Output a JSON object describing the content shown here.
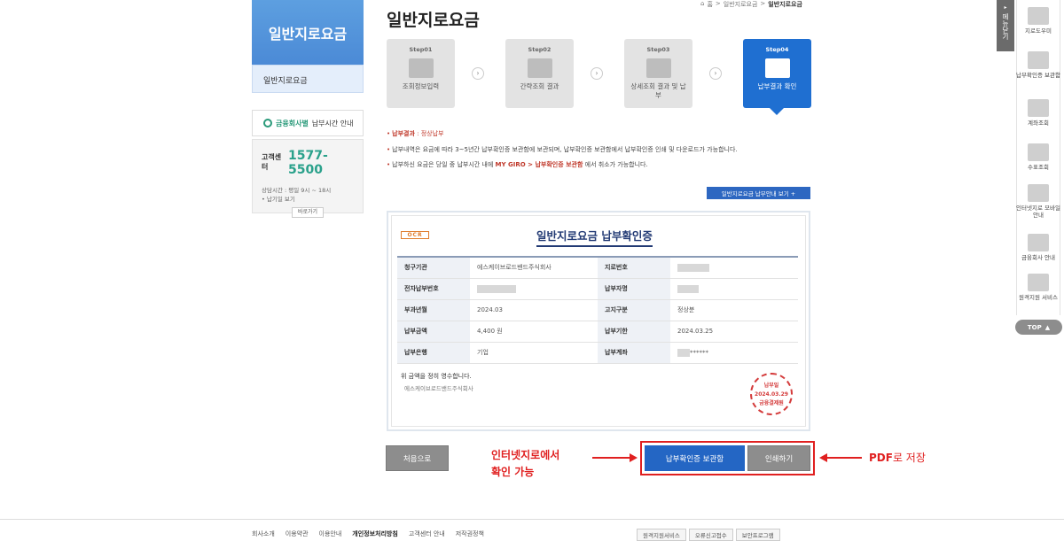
{
  "sidebar": {
    "title": "일반지로요금",
    "item": "일반지로요금",
    "notice_highlight": "금융회사별",
    "notice_text": "납부시간 안내",
    "cs_label": "고객센터",
    "cs_number": "1577-5500",
    "cs_hours": "상담시간 : 평일 9시 ~ 18시",
    "cs_holiday": "• 납기일 보기",
    "cs_button": "바로가기"
  },
  "header": {
    "title": "일반지로요금",
    "breadcrumb": [
      "홈",
      ">",
      "일반지로요금",
      ">",
      "일반지로요금"
    ]
  },
  "steps": [
    {
      "no": "Step01",
      "label": "조회정보입력"
    },
    {
      "no": "Step02",
      "label": "간략조회 결과"
    },
    {
      "no": "Step03",
      "label": "상세조회 결과 및 납부"
    },
    {
      "no": "Step04",
      "label": "납부결과 확인"
    }
  ],
  "info": {
    "result_label": "납부결과",
    "result_value": " : 정상납부",
    "line2": "납부내역은 요금에 따라 3~5년간 납부확인증 보관함에 보관되며, 납부확인증 보관함에서 납부확인증 인쇄 및 다운로드가 가능합니다.",
    "line3_pre": "납부하신 요금은 당일 중 납부시간 내에",
    "line3_link": "MY GIRO > 납부확인증 보관함",
    "line3_post": "에서 취소가 가능합니다.",
    "guide_button": "일반지로요금 납부안내 보기 +"
  },
  "receipt": {
    "ocr": "OCR",
    "title": "일반지로요금 납부확인증",
    "rows": [
      {
        "k1": "청구기관",
        "v1": "에스케이브로드밴드주식회사",
        "k2": "지로번호",
        "v2": ""
      },
      {
        "k1": "전자납부번호",
        "v1": "",
        "k2": "납부자명",
        "v2": ""
      },
      {
        "k1": "부과년월",
        "v1": "2024.03",
        "k2": "고지구분",
        "v2": "정상분"
      },
      {
        "k1": "납부금액",
        "v1": "4,400 원",
        "k2": "납부기한",
        "v2": "2024.03.25"
      },
      {
        "k1": "납부은행",
        "v1": "기업",
        "k2": "납부계좌",
        "v2": "******"
      }
    ],
    "foot1": "위 금액을 정히 영수합니다.",
    "foot2": "에스케이브로드밴드주식회사",
    "stamp_top": "납부일",
    "stamp_date": "2024.03.29",
    "stamp_bottom": "금융결제원"
  },
  "buttons": {
    "home": "처음으로",
    "vault": "납부확인증 보관함",
    "print": "인쇄하기"
  },
  "annotations": {
    "left": "인터넷지로에서\n확인 가능",
    "right_pdf": "PDF",
    "right_rest": "로 저장"
  },
  "footer": {
    "links": [
      "회사소개",
      "이용약관",
      "이용안내",
      "개인정보처리방침",
      "고객센터 안내",
      "저작권정책"
    ],
    "buttons": [
      "원격지원서비스",
      "오류신고접수",
      "보안프로그램"
    ]
  },
  "quickmenu": {
    "tab": "메뉴닫기",
    "items": [
      "지로도우미",
      "납부확인증 보관함",
      "계좌조회",
      "수표조회",
      "인터넷지로 모바일안내",
      "금융회사 안내",
      "원격지원 서비스"
    ],
    "top": "TOP"
  },
  "colors": {
    "brand_blue": "#1f6fd1",
    "accent_green": "#2aa18b",
    "annotation_red": "#e02020"
  }
}
